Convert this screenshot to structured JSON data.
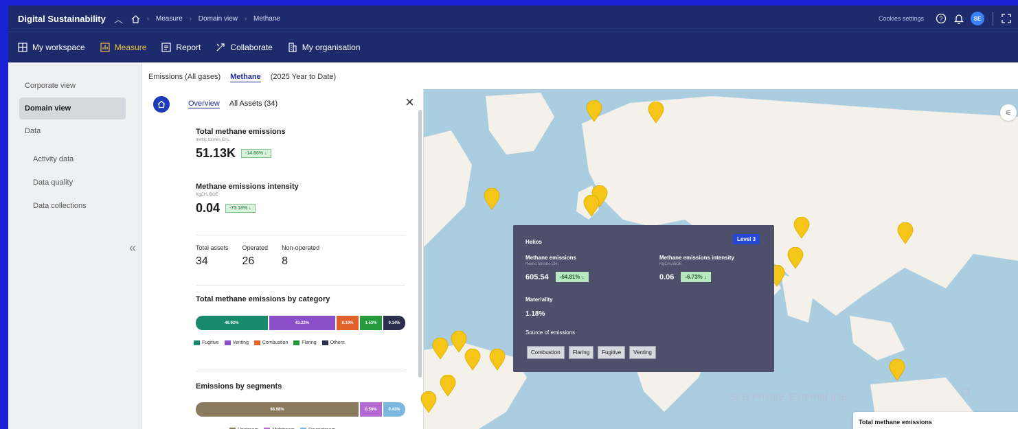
{
  "header": {
    "app_title": "Digital Sustainability",
    "breadcrumbs": [
      "Measure",
      "Domain view",
      "Methane"
    ],
    "cookies_label": "Cookies settings",
    "avatar_initials": "SE",
    "icons": [
      "chevron-up-icon",
      "home-icon",
      "help-icon",
      "bell-icon",
      "fullscreen-icon"
    ]
  },
  "nav": {
    "items": [
      {
        "label": "My workspace",
        "icon": "grid-icon"
      },
      {
        "label": "Measure",
        "icon": "chart-icon",
        "active": true
      },
      {
        "label": "Report",
        "icon": "document-icon"
      },
      {
        "label": "Collaborate",
        "icon": "share-icon"
      },
      {
        "label": "My organisation",
        "icon": "building-icon"
      }
    ]
  },
  "sidebar": {
    "items": [
      {
        "label": "Corporate view"
      },
      {
        "label": "Domain view",
        "active": true
      },
      {
        "label": "Data"
      },
      {
        "label": "Activity data"
      },
      {
        "label": "Data quality"
      },
      {
        "label": "Data collections"
      }
    ],
    "collapse_icon": "«"
  },
  "view_tabs": {
    "all_gases": "Emissions (All gases)",
    "methane": "Methane",
    "period": "(2025 Year to Date)"
  },
  "panel": {
    "tabs": {
      "overview": "Overview",
      "all_assets": "All Assets (34)"
    },
    "close_icon": "×",
    "total": {
      "title": "Total methane emissions",
      "unit": "metric tonnes CH₄",
      "value": "51.13K",
      "delta": "-14.66% ↓"
    },
    "intensity": {
      "title": "Methane emissions intensity",
      "unit": "KgCH₄/BOE",
      "value": "0.04",
      "delta": "-73.18% ↓"
    },
    "counts": [
      {
        "label": "Total assets",
        "value": "34"
      },
      {
        "label": "Operated",
        "value": "26"
      },
      {
        "label": "Non-operated",
        "value": "8"
      }
    ],
    "by_category": {
      "title": "Total methane emissions by category",
      "segments": [
        {
          "label": "46.92%",
          "share": 46.92,
          "color": "#1a8a6e"
        },
        {
          "label": "43.22%",
          "share": 43.22,
          "color": "#8a4fc8"
        },
        {
          "label": "8.19%",
          "share": 8.19,
          "color": "#e2602a"
        },
        {
          "label": "1.53%",
          "share": 1.53,
          "color": "#249a3c"
        },
        {
          "label": "0.14%",
          "share": 0.14,
          "color": "#2a2f4e"
        }
      ],
      "legend": [
        {
          "label": "Fugitive",
          "color": "#1a8a6e"
        },
        {
          "label": "Venting",
          "color": "#8a4fc8"
        },
        {
          "label": "Combustion",
          "color": "#e2602a"
        },
        {
          "label": "Flaring",
          "color": "#249a3c"
        },
        {
          "label": "Others",
          "color": "#2a2f4e"
        }
      ]
    },
    "by_segment": {
      "title": "Emissions by segments",
      "segments": [
        {
          "label": "98.98%",
          "share": 98.98,
          "color": "#8a7a5e"
        },
        {
          "label": "0.59%",
          "share": 0.59,
          "color": "#b56ad2"
        },
        {
          "label": "0.43%",
          "share": 0.43,
          "color": "#7ab8e0"
        }
      ],
      "legend": [
        {
          "label": "Upstream",
          "color": "#8a7a5e"
        },
        {
          "label": "Midstream",
          "color": "#b56ad2"
        },
        {
          "label": "Downstream",
          "color": "#7ab8e0"
        }
      ]
    }
  },
  "tooltip": {
    "asset": "Helios",
    "level": "Level 3",
    "emissions": {
      "label": "Methane emissions",
      "unit": "metric tonnes CH₄",
      "value": "605.54",
      "delta": "-64.81% ↓"
    },
    "intensity": {
      "label": "Methane emissions intensity",
      "unit": "KgCH₄/BOE",
      "value": "0.06",
      "delta": "-6.73% ↓"
    },
    "materiality_label": "Materiality",
    "materiality_value": "1.18%",
    "source_label": "Source of emissions",
    "sources": [
      "Combustion",
      "Flaring",
      "Fugitive",
      "Venting"
    ]
  },
  "footer": {
    "note": "SLB Private. External use.",
    "page_number": "13",
    "mini_card_title": "Total methane emissions"
  },
  "colors": {
    "header_bg": "#1d2a6b",
    "accent": "#f2c230",
    "pin": "#f5c518",
    "ocean": "#aacde0",
    "land": "#f3f1e9"
  }
}
